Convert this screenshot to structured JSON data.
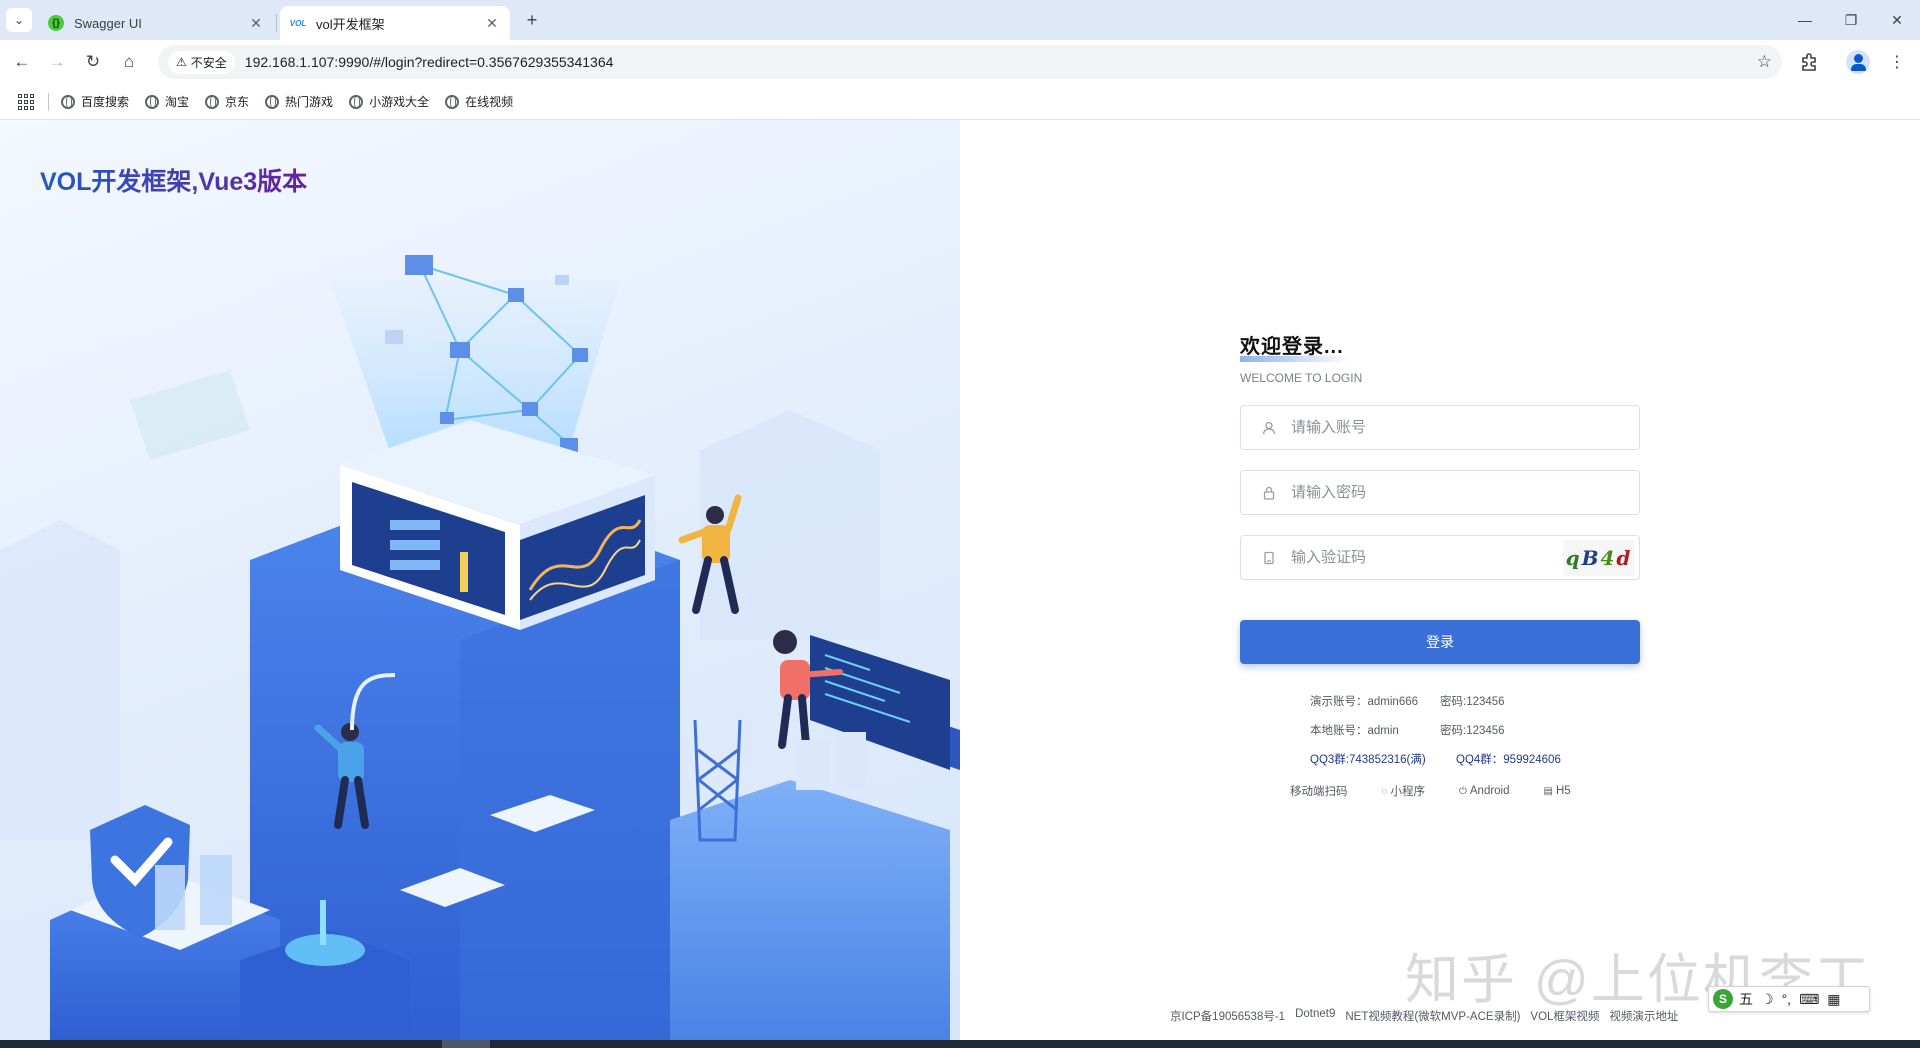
{
  "browser": {
    "tabs": [
      {
        "title": "Swagger UI",
        "favicon": "swagger-icon",
        "active": false
      },
      {
        "title": "vol开发框架",
        "favicon": "vol-icon",
        "active": true
      }
    ],
    "tab_close_glyph": "✕",
    "new_tab_glyph": "+",
    "window_controls": {
      "minimize": "—",
      "restore": "❐",
      "close": "✕"
    },
    "nav": {
      "back": "←",
      "forward": "→",
      "reload": "↻",
      "home": "⌂"
    },
    "security_label": "不安全",
    "url": "192.168.1.107:9990/#/login?redirect=0.3567629355341364",
    "bookmarks": [
      "百度搜索",
      "淘宝",
      "京东",
      "热门游戏",
      "小游戏大全",
      "在线视频"
    ]
  },
  "hero": {
    "brand": "VOL开发框架,Vue3版本"
  },
  "login": {
    "title": "欢迎登录...",
    "subtitle": "WELCOME TO LOGIN",
    "username_placeholder": "请输入账号",
    "password_placeholder": "请输入密码",
    "captcha_placeholder": "输入验证码",
    "captcha_chars": [
      "q",
      "B",
      "4",
      "d"
    ],
    "submit_label": "登录",
    "demo_account": "演示账号：admin666",
    "demo_password": "密码:123456",
    "local_account": "本地账号：admin",
    "local_password": "密码:123456",
    "qq3": "QQ3群:743852316(满)",
    "qq4": "QQ4群：959924606",
    "apps": [
      {
        "label": "移动端扫码",
        "icon": ""
      },
      {
        "label": "小程序",
        "icon": "chat-bubble-icon"
      },
      {
        "label": "Android",
        "icon": "power-icon"
      },
      {
        "label": "H5",
        "icon": "document-icon"
      }
    ]
  },
  "footer": {
    "links": [
      "京ICP备19056538号-1",
      "Dotnet9",
      "NET视频教程(微软MVP-ACE录制)",
      "VOL框架视频",
      "视频演示地址"
    ]
  },
  "watermark": "知乎 @上位机李工",
  "ime": {
    "logo": "S",
    "mode": "五",
    "items": [
      "☽",
      "°,",
      "⌨",
      "▦"
    ]
  },
  "colors": {
    "accent": "#3a6fd8",
    "brand_start": "#1d5cc4",
    "brand_end": "#6a1fa0"
  }
}
